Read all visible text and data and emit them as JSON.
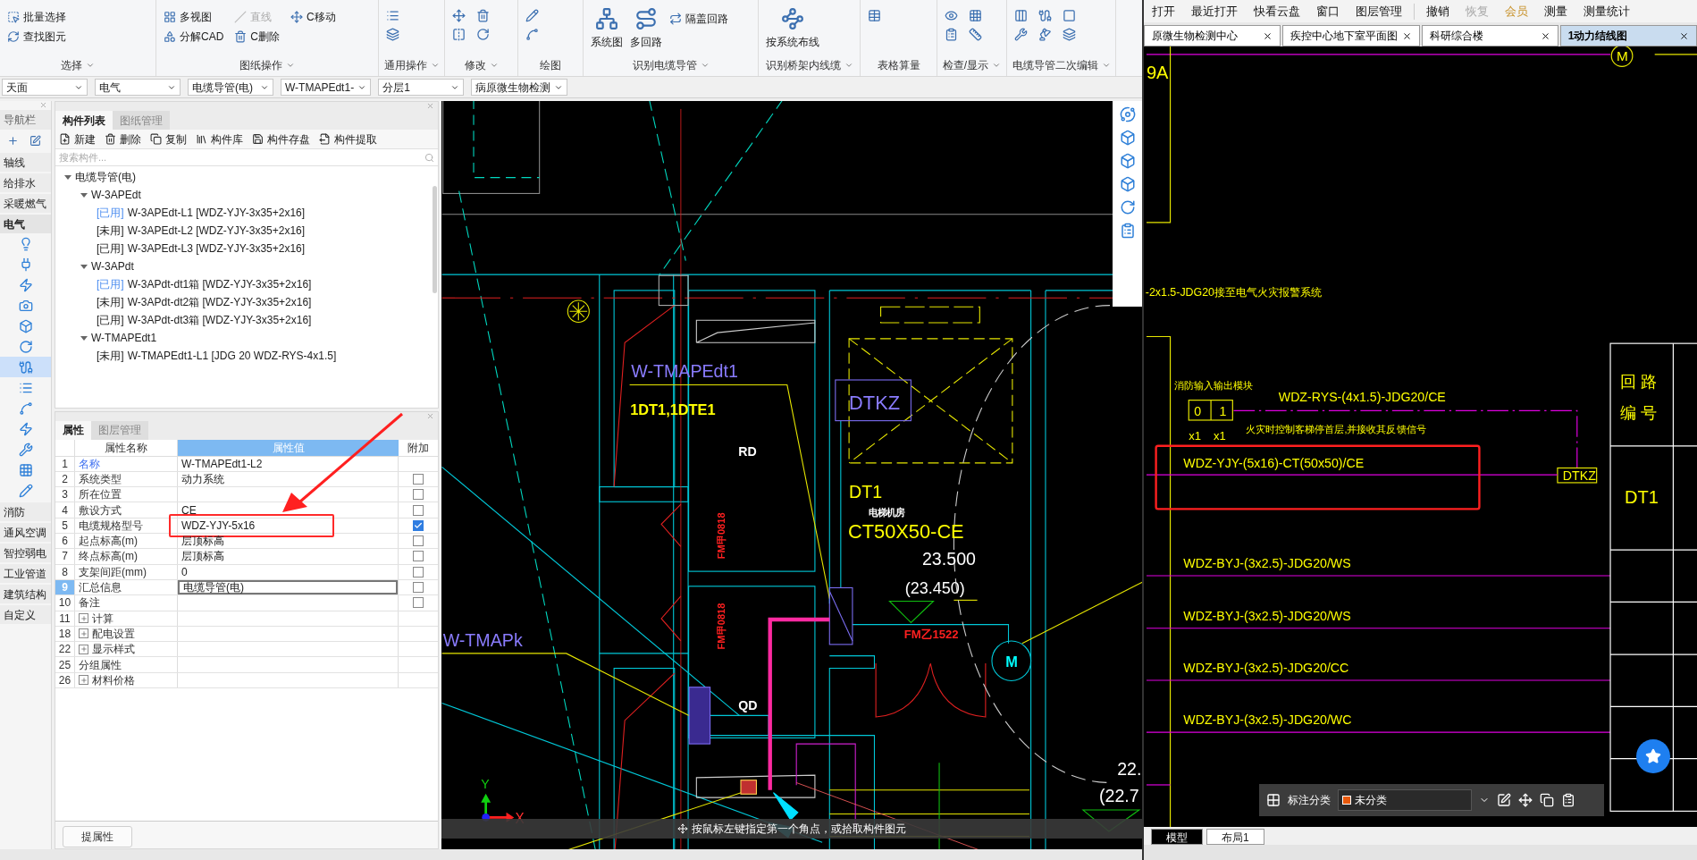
{
  "ribbon": {
    "groups": [
      {
        "label": "选择",
        "kind": "tools",
        "menu": true,
        "tools": [
          {
            "label": "批量选择",
            "disabled": false
          },
          {
            "label": "查找图元",
            "disabled": false
          }
        ]
      },
      {
        "label": "图纸操作",
        "kind": "tools",
        "menu": true,
        "tools": [
          {
            "label": "多视图",
            "disabled": false
          },
          {
            "label": "分解CAD",
            "disabled": false
          },
          {
            "label": "直线",
            "disabled": true
          },
          {
            "label": "C删除",
            "disabled": false
          },
          {
            "label": "C移动",
            "disabled": false
          }
        ]
      },
      {
        "label": "通用操作",
        "kind": "icons",
        "menu": true
      },
      {
        "label": "修改",
        "kind": "icons",
        "menu": true
      },
      {
        "label": "绘图",
        "kind": "icons",
        "menu": false
      },
      {
        "label": "识别电缆导管",
        "kind": "tools",
        "menu": true,
        "tools": [
          {
            "label": "系统图",
            "kind": "large",
            "disabled": false
          },
          {
            "label": "多回路",
            "kind": "large",
            "disabled": false
          },
          {
            "label": "隔盖回路",
            "kind": "small",
            "disabled": false
          }
        ]
      },
      {
        "label": "识别桥架内线缆",
        "kind": "tools",
        "menu": true,
        "tools": [
          {
            "label": "按系统布线",
            "kind": "large",
            "disabled": false
          }
        ]
      },
      {
        "label": "表格算量",
        "kind": "icons",
        "menu": false
      },
      {
        "label": "检查/显示",
        "kind": "icons",
        "menu": true
      },
      {
        "label": "电缆导管二次编辑",
        "kind": "icons",
        "menu": true
      }
    ]
  },
  "selectors": [
    "天面",
    "电气",
    "电缆导管(电)",
    "W-TMAPEdt1-",
    "分层1",
    "病原微生物检测"
  ],
  "nav": {
    "title": "导航栏",
    "categories": [
      {
        "label": "轴线",
        "expanded": false
      },
      {
        "label": "给排水",
        "expanded": false
      },
      {
        "label": "采暖燃气",
        "expanded": false
      },
      {
        "label": "电气",
        "expanded": true,
        "tools": [
          {
            "selected": false
          },
          {
            "selected": false
          },
          {
            "selected": false
          },
          {
            "selected": false
          },
          {
            "selected": false
          },
          {
            "selected": false
          },
          {
            "selected": true
          },
          {
            "selected": false
          },
          {
            "selected": false
          },
          {
            "selected": false
          },
          {
            "selected": false
          },
          {
            "selected": false
          },
          {
            "selected": false
          }
        ]
      },
      {
        "label": "消防",
        "expanded": false
      },
      {
        "label": "通风空调",
        "expanded": false
      },
      {
        "label": "智控弱电",
        "expanded": false
      },
      {
        "label": "工业管道",
        "expanded": false
      },
      {
        "label": "建筑结构",
        "expanded": false
      },
      {
        "label": "自定义",
        "expanded": false
      }
    ]
  },
  "components": {
    "tabs": [
      {
        "label": "构件列表",
        "selected": true
      },
      {
        "label": "图纸管理",
        "selected": false
      }
    ],
    "toolbar": [
      "新建",
      "删除",
      "复制",
      "构件库",
      "构件存盘",
      "构件提取"
    ],
    "search": {
      "placeholder": "搜索构件..."
    },
    "tree": [
      {
        "label": "电缆导管(电)",
        "expanded": true,
        "children": [
          {
            "label": "W-3APEdt",
            "expanded": true,
            "children": [
              {
                "status": "[已用]",
                "label": "W-3APEdt-L1 [WDZ-YJY-3x35+2x16]",
                "highlighted": true
              },
              {
                "status": "[未用]",
                "label": "W-3APEdt-L2 [WDZ-YJY-3x35+2x16]",
                "highlighted": false
              },
              {
                "status": "[已用]",
                "label": "W-3APEdt-L3 [WDZ-YJY-3x35+2x16]",
                "highlighted": false
              }
            ]
          },
          {
            "label": "W-3APdt",
            "expanded": true,
            "children": [
              {
                "status": "[已用]",
                "label": "W-3APdt-dt1箱 [WDZ-YJY-3x35+2x16]",
                "highlighted": true
              },
              {
                "status": "[未用]",
                "label": "W-3APdt-dt2箱 [WDZ-YJY-3x35+2x16]",
                "highlighted": false
              },
              {
                "status": "[已用]",
                "label": "W-3APdt-dt3箱 [WDZ-YJY-3x35+2x16]",
                "highlighted": false
              }
            ]
          },
          {
            "label": "W-TMAPEdt1",
            "expanded": true,
            "children": [
              {
                "status": "[未用]",
                "label": "W-TMAPEdt1-L1 [JDG 20 WDZ-RYS-4x1.5]",
                "highlighted": false
              }
            ]
          }
        ]
      }
    ]
  },
  "properties": {
    "tabs": [
      {
        "label": "属性",
        "selected": true
      },
      {
        "label": "图层管理",
        "selected": false
      }
    ],
    "columns": [
      "属性名称",
      "属性值",
      "附加"
    ],
    "rows": [
      {
        "num": "1",
        "name": "名称",
        "value": "W-TMAPEdt1-L2",
        "kind": "link",
        "selected": false,
        "boxed": false
      },
      {
        "num": "2",
        "name": "系统类型",
        "value": "动力系统",
        "kind": "field",
        "checked": false,
        "selected": false,
        "boxed": false
      },
      {
        "num": "3",
        "name": "所在位置",
        "kind": "field",
        "checked": false,
        "selected": false,
        "boxed": false
      },
      {
        "num": "4",
        "name": "敷设方式",
        "value": "CE",
        "kind": "field",
        "checked": false,
        "selected": false,
        "boxed": false
      },
      {
        "num": "5",
        "name": "电缆规格型号",
        "value": "WDZ-YJY-5x16",
        "kind": "field",
        "checked": true,
        "selected": false,
        "boxed": true
      },
      {
        "num": "6",
        "name": "起点标高(m)",
        "value": "层顶标高",
        "kind": "field",
        "checked": false,
        "selected": false,
        "boxed": false
      },
      {
        "num": "7",
        "name": "终点标高(m)",
        "value": "层顶标高",
        "kind": "field",
        "checked": false,
        "selected": false,
        "boxed": false
      },
      {
        "num": "8",
        "name": "支架间距(mm)",
        "value": "0",
        "kind": "field",
        "checked": false,
        "selected": false,
        "boxed": false
      },
      {
        "num": "9",
        "name": "汇总信息",
        "value": "电缆导管(电)",
        "kind": "field",
        "checked": false,
        "selected": true,
        "boxed": false
      },
      {
        "num": "10",
        "name": "备注",
        "kind": "field",
        "checked": false,
        "selected": false,
        "boxed": false
      },
      {
        "num": "11",
        "name": "计算",
        "kind": "group",
        "expanded": false,
        "selected": false,
        "boxed": false
      },
      {
        "num": "18",
        "name": "配电设置",
        "kind": "group",
        "expanded": false,
        "selected": false,
        "boxed": false
      },
      {
        "num": "22",
        "name": "显示样式",
        "kind": "group",
        "expanded": false,
        "selected": false,
        "boxed": false
      },
      {
        "num": "25",
        "name": "分组属性",
        "kind": "plain",
        "selected": false,
        "boxed": false
      },
      {
        "num": "26",
        "name": "材料价格",
        "kind": "group",
        "expanded": false,
        "selected": false,
        "boxed": false
      }
    ],
    "button": "提属性"
  },
  "canvas": {
    "annotations": [
      {
        "text": "W-TMAPEdt1",
        "color": "#8a7cff"
      },
      {
        "text": "1DT1,1DTE1",
        "color": "#ffff00"
      },
      {
        "text": "RD",
        "color": "#ffffff"
      },
      {
        "text": "FM甲0818",
        "color": "#ff2020"
      },
      {
        "text": "FM甲0818",
        "color": "#ff2020"
      },
      {
        "text": "DTKZ",
        "color": "#8a7cff"
      },
      {
        "text": "DT1",
        "color": "#ffff00"
      },
      {
        "text": "电梯机房",
        "color": "#ffffff"
      },
      {
        "text": "CT50X50-CE",
        "color": "#ffff00"
      },
      {
        "text": "23.500",
        "color": "#ffffff"
      },
      {
        "text": "(23.450)",
        "color": "#ffffff"
      },
      {
        "text": "W-TMAPk",
        "color": "#8a7cff"
      },
      {
        "text": "FM乙1522",
        "color": "#ff2020"
      },
      {
        "text": "QD",
        "color": "#ffffff"
      },
      {
        "text": "M",
        "color": "#00ffff"
      },
      {
        "text": "22.",
        "color": "#ffffff"
      },
      {
        "text": "(22.7",
        "color": "#ffffff"
      }
    ],
    "axes": {
      "x": "X",
      "y": "Y"
    },
    "prompt": "按鼠标左键指定第一个角点，或拾取构件图元"
  },
  "viewer": {
    "menu": [
      {
        "label": "打开",
        "disabled": false,
        "kind": "normal"
      },
      {
        "label": "最近打开",
        "disabled": false,
        "kind": "normal"
      },
      {
        "label": "快看云盘",
        "disabled": false,
        "kind": "normal"
      },
      {
        "label": "窗口",
        "disabled": false,
        "kind": "normal"
      },
      {
        "label": "图层管理",
        "disabled": false,
        "kind": "normal"
      }
    ],
    "edit_menu": [
      {
        "label": "撤销",
        "disabled": false,
        "kind": "normal"
      },
      {
        "label": "恢复",
        "disabled": true,
        "kind": "normal"
      },
      {
        "label": "会员",
        "disabled": false,
        "kind": "member"
      },
      {
        "label": "测量",
        "disabled": false,
        "kind": "normal"
      },
      {
        "label": "测量统计",
        "disabled": false,
        "kind": "normal"
      }
    ],
    "tabs": [
      {
        "label": "原微生物检测中心",
        "selected": false
      },
      {
        "label": "疾控中心地下室平面图",
        "selected": false
      },
      {
        "label": "科研综合楼",
        "selected": false
      },
      {
        "label": "1动力结线图",
        "selected": true
      }
    ],
    "diagram_texts": [
      "M",
      "9A",
      "-2x1.5-JDG20接至电气火灾报警系统",
      "消防输入输出模块",
      "WDZ-RYS-(4x1.5)-JDG20/CE",
      "0",
      "1",
      "x1",
      "x1",
      "火灾时控制客梯停首层,并接收其反馈信号",
      "WDZ-YJY-(5x16)-CT(50x50)/CE",
      "DTKZ",
      "回 路",
      "编 号",
      "DT1",
      "WDZ-BYJ-(3x2.5)-JDG20/WS",
      "WDZ-BYJ-(3x2.5)-JDG20/WS",
      "WDZ-BYJ-(3x2.5)-JDG20/CC",
      "WDZ-BYJ-(3x2.5)-JDG20/WC"
    ],
    "annotation_bar": {
      "label": "标注分类",
      "category": "未分类"
    },
    "layout_tabs": [
      {
        "label": "模型",
        "selected": true
      },
      {
        "label": "布局1",
        "selected": false
      }
    ]
  }
}
